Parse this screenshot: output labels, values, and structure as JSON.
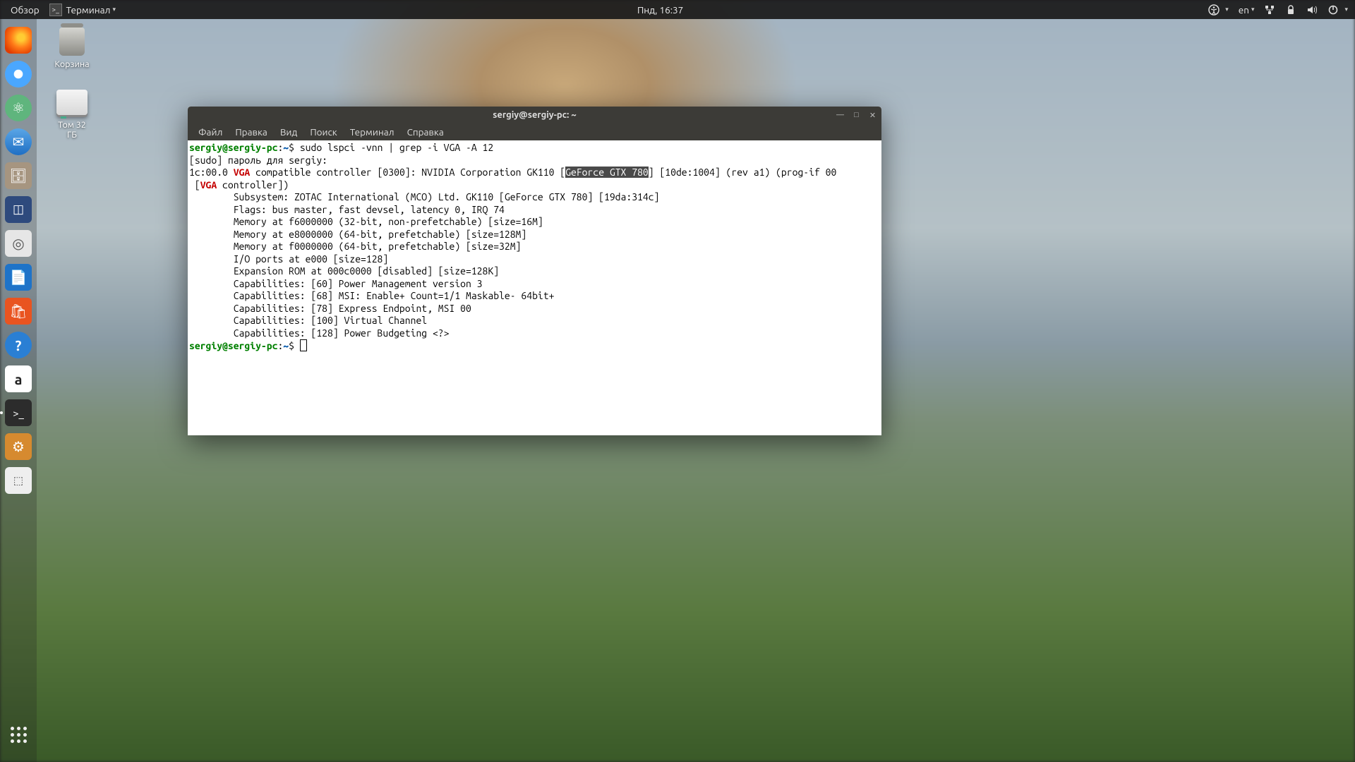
{
  "topbar": {
    "activities": "Обзор",
    "app_icon": "▣",
    "app_name": "Терминал",
    "clock": "Пнд, 16:37",
    "lang": "en"
  },
  "desktop": {
    "trash_label": "Корзина",
    "drive_label_1": "Том 32",
    "drive_label_2": "ГБ"
  },
  "terminal": {
    "title": "sergiy@sergiy-pc: ~",
    "menu": {
      "file": "Файл",
      "edit": "Правка",
      "view": "Вид",
      "search": "Поиск",
      "terminal": "Терминал",
      "help": "Справка"
    },
    "prompt": {
      "user": "sergiy@sergiy-pc",
      "path": "~",
      "sep": ":",
      "end": "$"
    },
    "cmd": "sudo lspci -vnn | grep -i VGA -A 12",
    "sudo_line": "[sudo] пароль для sergiy:",
    "lspci": {
      "pre": "1c:00.0 ",
      "vga1": "VGA",
      "mid1": " compatible controller [0300]: NVIDIA Corporation GK110 [",
      "highlight": "GeForce GTX 780",
      "mid2": "] [10de:1004] (rev a1) (prog-if 00",
      "line2_pre": " [",
      "vga2": "VGA",
      "line2_post": " controller])",
      "sub": "        Subsystem: ZOTAC International (MCO) Ltd. GK110 [GeForce GTX 780] [19da:314c]",
      "flags": "        Flags: bus master, fast devsel, latency 0, IRQ 74",
      "mem1": "        Memory at f6000000 (32-bit, non-prefetchable) [size=16M]",
      "mem2": "        Memory at e8000000 (64-bit, prefetchable) [size=128M]",
      "mem3": "        Memory at f0000000 (64-bit, prefetchable) [size=32M]",
      "io": "        I/O ports at e000 [size=128]",
      "rom": "        Expansion ROM at 000c0000 [disabled] [size=128K]",
      "cap1": "        Capabilities: [60] Power Management version 3",
      "cap2": "        Capabilities: [68] MSI: Enable+ Count=1/1 Maskable- 64bit+",
      "cap3": "        Capabilities: [78] Express Endpoint, MSI 00",
      "cap4": "        Capabilities: [100] Virtual Channel",
      "cap5": "        Capabilities: [128] Power Budgeting <?>"
    }
  }
}
